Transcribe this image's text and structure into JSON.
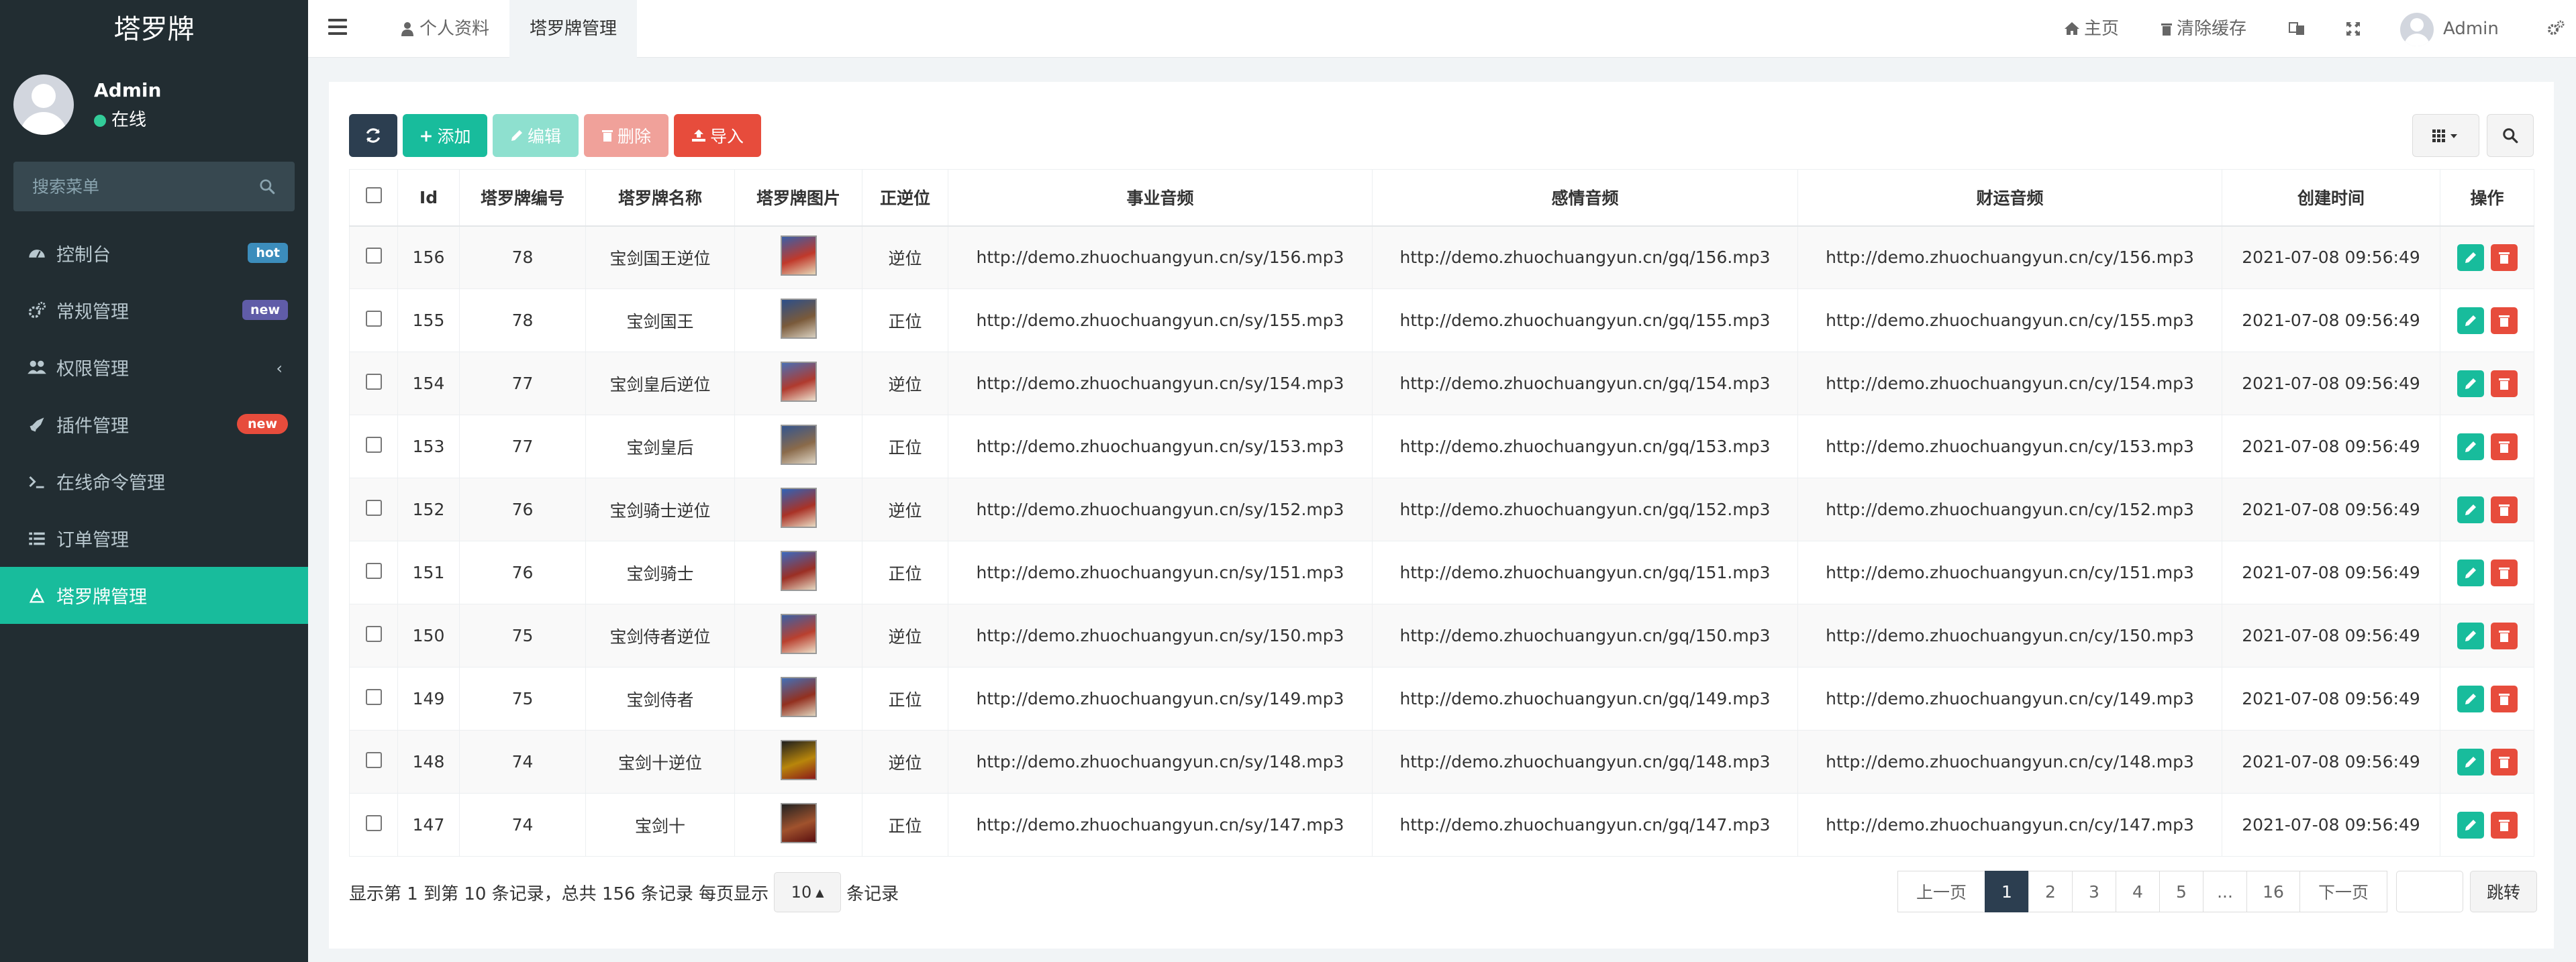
{
  "app": {
    "brand": "塔罗牌"
  },
  "user": {
    "name": "Admin",
    "status": "在线"
  },
  "sidebar": {
    "search_placeholder": "搜索菜单",
    "items": [
      {
        "label": "控制台",
        "icon": "dashboard-icon",
        "badge": "hot",
        "badge_color": "#3c8dbc"
      },
      {
        "label": "常规管理",
        "icon": "cogs-icon",
        "badge": "new",
        "badge_color": "#605ca8"
      },
      {
        "label": "权限管理",
        "icon": "group-icon",
        "chevron": "‹"
      },
      {
        "label": "插件管理",
        "icon": "rocket-icon",
        "badge": "new",
        "badge_color": "#e74c3c"
      },
      {
        "label": "在线命令管理",
        "icon": "terminal-icon"
      },
      {
        "label": "订单管理",
        "icon": "list-icon"
      },
      {
        "label": "塔罗牌管理",
        "icon": "tarot-icon",
        "active": true
      }
    ]
  },
  "header": {
    "tabs": [
      {
        "label": "个人资料",
        "icon": "user-icon"
      },
      {
        "label": "塔罗牌管理",
        "active": true
      }
    ],
    "home": "主页",
    "clear_cache": "清除缓存",
    "admin": "Admin"
  },
  "toolbar": {
    "add": "添加",
    "edit": "编辑",
    "delete": "删除",
    "import": "导入",
    "colors": {
      "refresh": "#2c3e50",
      "add": "#18bc9c",
      "edit": "#8ee0cf",
      "delete": "#f0a19a",
      "import": "#e74c3c"
    }
  },
  "table": {
    "columns": [
      "Id",
      "塔罗牌编号",
      "塔罗牌名称",
      "塔罗牌图片",
      "正逆位",
      "事业音频",
      "感情音频",
      "财运音频",
      "创建时间",
      "操作"
    ],
    "rows": [
      {
        "id": "156",
        "no": "78",
        "name": "宝剑国王逆位",
        "pos": "逆位",
        "reversed": true,
        "sy": "http://demo.zhuochuangyun.cn/sy/156.mp3",
        "gq": "http://demo.zhuochuangyun.cn/gq/156.mp3",
        "cy": "http://demo.zhuochuangyun.cn/cy/156.mp3",
        "time": "2021-07-08 09:56:49"
      },
      {
        "id": "155",
        "no": "78",
        "name": "宝剑国王",
        "pos": "正位",
        "reversed": false,
        "sy": "http://demo.zhuochuangyun.cn/sy/155.mp3",
        "gq": "http://demo.zhuochuangyun.cn/gq/155.mp3",
        "cy": "http://demo.zhuochuangyun.cn/cy/155.mp3",
        "time": "2021-07-08 09:56:49"
      },
      {
        "id": "154",
        "no": "77",
        "name": "宝剑皇后逆位",
        "pos": "逆位",
        "reversed": true,
        "sy": "http://demo.zhuochuangyun.cn/sy/154.mp3",
        "gq": "http://demo.zhuochuangyun.cn/gq/154.mp3",
        "cy": "http://demo.zhuochuangyun.cn/cy/154.mp3",
        "time": "2021-07-08 09:56:49"
      },
      {
        "id": "153",
        "no": "77",
        "name": "宝剑皇后",
        "pos": "正位",
        "reversed": false,
        "sy": "http://demo.zhuochuangyun.cn/sy/153.mp3",
        "gq": "http://demo.zhuochuangyun.cn/gq/153.mp3",
        "cy": "http://demo.zhuochuangyun.cn/cy/153.mp3",
        "time": "2021-07-08 09:56:49"
      },
      {
        "id": "152",
        "no": "76",
        "name": "宝剑骑士逆位",
        "pos": "逆位",
        "reversed": true,
        "sy": "http://demo.zhuochuangyun.cn/sy/152.mp3",
        "gq": "http://demo.zhuochuangyun.cn/gq/152.mp3",
        "cy": "http://demo.zhuochuangyun.cn/cy/152.mp3",
        "time": "2021-07-08 09:56:49"
      },
      {
        "id": "151",
        "no": "76",
        "name": "宝剑骑士",
        "pos": "正位",
        "reversed": false,
        "sy": "http://demo.zhuochuangyun.cn/sy/151.mp3",
        "gq": "http://demo.zhuochuangyun.cn/gq/151.mp3",
        "cy": "http://demo.zhuochuangyun.cn/cy/151.mp3",
        "time": "2021-07-08 09:56:49"
      },
      {
        "id": "150",
        "no": "75",
        "name": "宝剑侍者逆位",
        "pos": "逆位",
        "reversed": true,
        "sy": "http://demo.zhuochuangyun.cn/sy/150.mp3",
        "gq": "http://demo.zhuochuangyun.cn/gq/150.mp3",
        "cy": "http://demo.zhuochuangyun.cn/cy/150.mp3",
        "time": "2021-07-08 09:56:49"
      },
      {
        "id": "149",
        "no": "75",
        "name": "宝剑侍者",
        "pos": "正位",
        "reversed": false,
        "sy": "http://demo.zhuochuangyun.cn/sy/149.mp3",
        "gq": "http://demo.zhuochuangyun.cn/gq/149.mp3",
        "cy": "http://demo.zhuochuangyun.cn/cy/149.mp3",
        "time": "2021-07-08 09:56:49"
      },
      {
        "id": "148",
        "no": "74",
        "name": "宝剑十逆位",
        "pos": "逆位",
        "reversed": true,
        "sy": "http://demo.zhuochuangyun.cn/sy/148.mp3",
        "gq": "http://demo.zhuochuangyun.cn/gq/148.mp3",
        "cy": "http://demo.zhuochuangyun.cn/cy/148.mp3",
        "time": "2021-07-08 09:56:49"
      },
      {
        "id": "147",
        "no": "74",
        "name": "宝剑十",
        "pos": "正位",
        "reversed": false,
        "sy": "http://demo.zhuochuangyun.cn/sy/147.mp3",
        "gq": "http://demo.zhuochuangyun.cn/gq/147.mp3",
        "cy": "http://demo.zhuochuangyun.cn/cy/147.mp3",
        "time": "2021-07-08 09:56:49"
      }
    ]
  },
  "footer": {
    "summary": "显示第 1 到第 10 条记录，总共 156 条记录 每页显示",
    "per_page": "10",
    "suffix": "条记录"
  },
  "pagination": {
    "prev": "上一页",
    "pages": [
      "1",
      "2",
      "3",
      "4",
      "5",
      "...",
      "16"
    ],
    "current": "1",
    "next": "下一页",
    "jump": "跳转"
  }
}
